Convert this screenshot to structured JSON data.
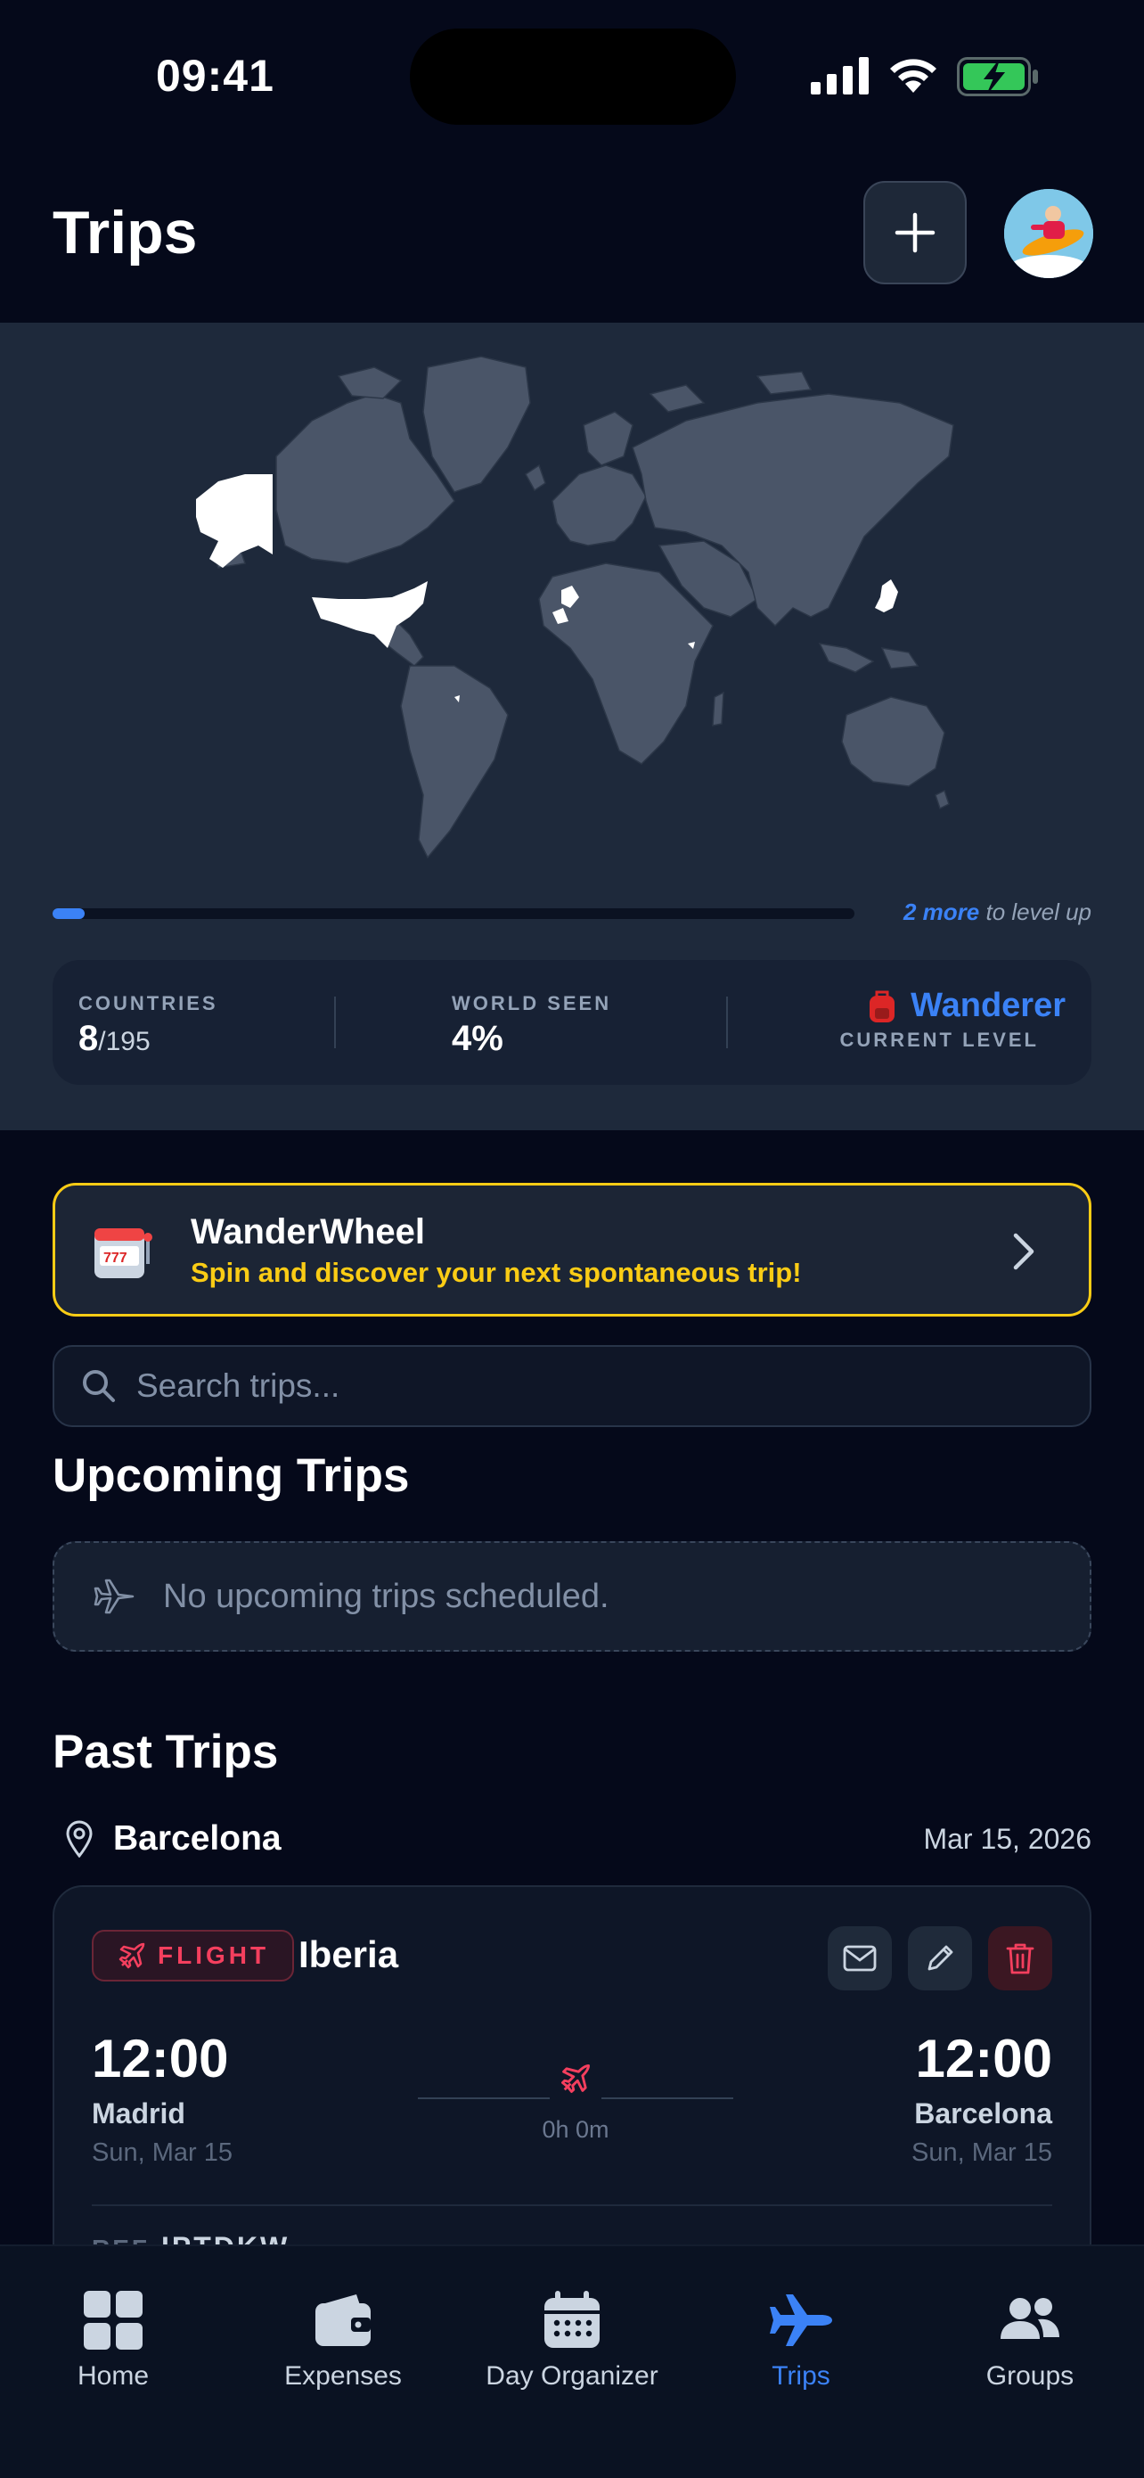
{
  "status_bar": {
    "time": "09:41"
  },
  "header": {
    "title": "Trips"
  },
  "map": {
    "progress_fraction": 0.04,
    "levelup_count": "2 more",
    "levelup_text": " to level up",
    "stats": {
      "countries_label": "COUNTRIES",
      "countries_value": "8",
      "countries_total": "/195",
      "world_label": "WORLD SEEN",
      "world_value": "4%",
      "level_name": "Wanderer",
      "level_label": "CURRENT LEVEL"
    }
  },
  "wanderwheel": {
    "title": "WanderWheel",
    "subtitle": "Spin and discover your next spontaneous trip!"
  },
  "search": {
    "placeholder": "Search trips..."
  },
  "upcoming": {
    "heading": "Upcoming Trips",
    "empty_text": "No upcoming trips scheduled."
  },
  "past": {
    "heading": "Past Trips",
    "trip": {
      "location": "Barcelona",
      "date": "Mar 15, 2026",
      "badge": "FLIGHT",
      "carrier": "Iberia",
      "dep_time": "12:00",
      "dep_city": "Madrid",
      "dep_date": "Sun, Mar 15",
      "duration": "0h 0m",
      "arr_time": "12:00",
      "arr_city": "Barcelona",
      "arr_date": "Sun, Mar 15",
      "ref_label": "REF",
      "ref_value": "IPTDKW"
    }
  },
  "tabs": [
    {
      "label": "Home",
      "icon": "home-grid-icon"
    },
    {
      "label": "Expenses",
      "icon": "wallet-icon"
    },
    {
      "label": "Day Organizer",
      "icon": "calendar-icon"
    },
    {
      "label": "Trips",
      "icon": "airplane-icon",
      "active": true
    },
    {
      "label": "Groups",
      "icon": "people-icon"
    }
  ],
  "colors": {
    "background": "#05091a",
    "accent": "#3b82f6",
    "highlight": "#facc15",
    "danger": "#f43f5e"
  }
}
